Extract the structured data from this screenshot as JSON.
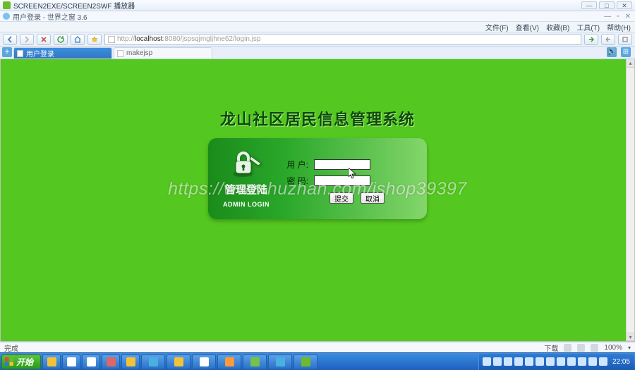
{
  "outer_window": {
    "title": "SCREEN2EXE/SCREEN2SWF 播放器"
  },
  "browser": {
    "title": "用户登录 - 世界之窗 3.6",
    "menus": [
      "文件(F)",
      "查看(V)",
      "收藏(B)",
      "工具(T)",
      "帮助(H)"
    ],
    "address_prefix": "http://",
    "address_host": "localhost",
    "address_rest": ":8080/jspsqjmgljhne62/login.jsp",
    "tabs": [
      {
        "label": "用户登录",
        "active": true
      },
      {
        "label": "makejsp",
        "active": false
      }
    ]
  },
  "page": {
    "system_title": "龙山社区居民信息管理系统",
    "login_cn": "管理登陆",
    "login_en": "ADMIN  LOGIN",
    "field_user": "用  户:",
    "field_pass": "密   码:",
    "user_value": "",
    "pass_value": "",
    "btn_submit": "提交",
    "btn_reset": "取消"
  },
  "watermark": "https://www.huzhan.com/ishop39397",
  "status": {
    "left": "完成",
    "download": "下载",
    "zoom": "100%"
  },
  "taskbar": {
    "start": "开始",
    "clock": "22:05"
  },
  "colors": {
    "page_bg": "#54c820"
  }
}
